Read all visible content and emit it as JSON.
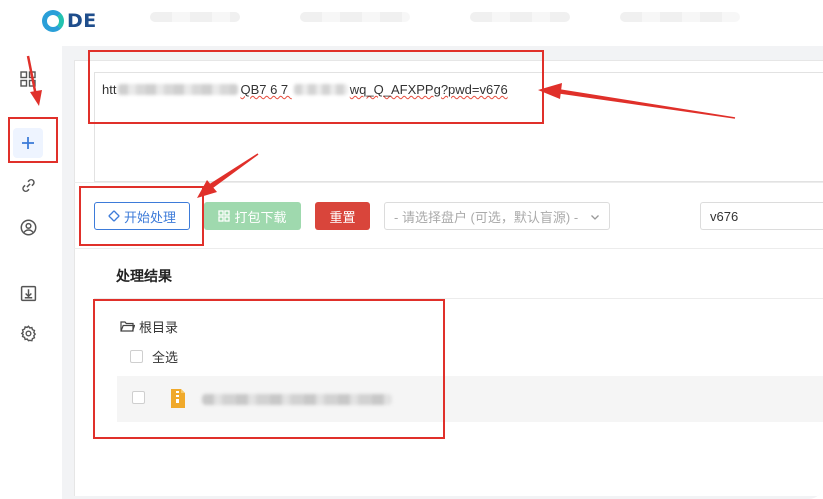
{
  "app": {
    "logo_text": "DE"
  },
  "sidebar": {
    "items": [
      {
        "icon": "grid-icon",
        "name": "sidebar-item-dashboard"
      },
      {
        "icon": "plus-icon",
        "name": "sidebar-item-add",
        "active": true
      },
      {
        "icon": "link-icon",
        "name": "sidebar-item-links"
      },
      {
        "icon": "user-circle-icon",
        "name": "sidebar-item-account"
      },
      {
        "icon": "download-icon",
        "name": "sidebar-item-downloads"
      },
      {
        "icon": "gear-icon",
        "name": "sidebar-item-settings"
      }
    ]
  },
  "url_input": {
    "prefix": "htt",
    "middle": "QB7  6 7 ",
    "suffix": "wq_Q_AFXPPg?pwd=v676"
  },
  "toolbar": {
    "start_label": "开始处理",
    "zip_label": "打包下载",
    "reset_label": "重置",
    "disk_placeholder": "- 请选择盘户 (可选，默认盲源) -",
    "password_value": "v676"
  },
  "results": {
    "title": "处理结果",
    "root_label": "根目录",
    "select_all_label": "全选",
    "files": [
      {
        "name_visible": false,
        "icon": "zip-file-icon"
      }
    ]
  },
  "colors": {
    "accent": "#3d7bd9",
    "zip_button": "#9fd9ae",
    "reset_button": "#d9453b",
    "annotation": "#e0302a"
  }
}
